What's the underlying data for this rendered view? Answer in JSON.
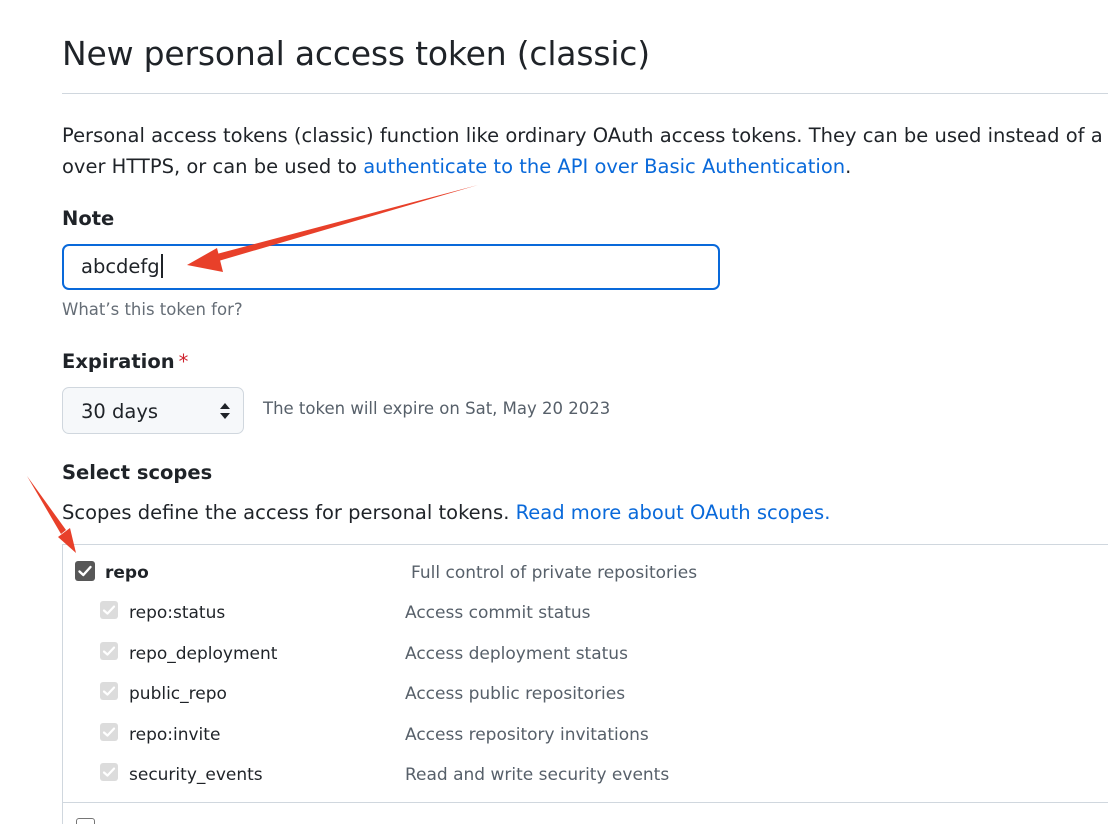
{
  "page": {
    "title": "New personal access token (classic)",
    "intro": {
      "text_before": "Personal access tokens (classic) function like ordinary OAuth access tokens. They can be used instead of a passwo",
      "text_line2": "over HTTPS, or can be used to ",
      "link": "authenticate to the API over Basic Authentication",
      "text_after": "."
    }
  },
  "note": {
    "label": "Note",
    "value": "abcdefg",
    "hint": "What’s this token for?"
  },
  "expiration": {
    "label": "Expiration",
    "required_mark": "*",
    "selected": "30 days",
    "info": "The token will expire on Sat, May 20 2023"
  },
  "scopes": {
    "label": "Select scopes",
    "description": "Scopes define the access for personal tokens. ",
    "link": "Read more about OAuth scopes.",
    "main": {
      "name": "repo",
      "description": "Full control of private repositories",
      "checked": true
    },
    "sub": [
      {
        "name": "repo:status",
        "description": "Access commit status",
        "checked": true
      },
      {
        "name": "repo_deployment",
        "description": "Access deployment status",
        "checked": true
      },
      {
        "name": "public_repo",
        "description": "Access public repositories",
        "checked": true
      },
      {
        "name": "repo:invite",
        "description": "Access repository invitations",
        "checked": true
      },
      {
        "name": "security_events",
        "description": "Read and write security events",
        "checked": true
      }
    ]
  },
  "colors": {
    "link": "#0969da",
    "focus_border": "#0969da",
    "annotation_arrow": "#e8402a",
    "required": "#cf222e"
  }
}
